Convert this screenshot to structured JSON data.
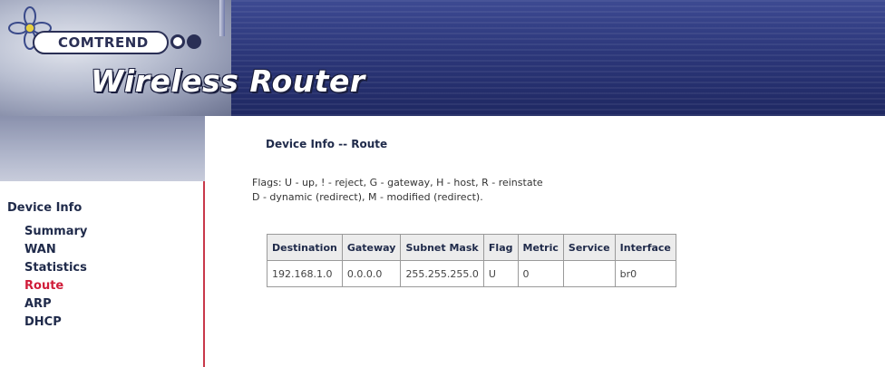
{
  "header": {
    "brand": "COMTREND",
    "product": "Wireless Router",
    "logo_icon": "flower-icon",
    "brand_color": "#2a2f55",
    "banner_color": "#2c377a"
  },
  "sidebar": {
    "heading": "Device Info",
    "items": [
      {
        "label": "Summary"
      },
      {
        "label": "WAN"
      },
      {
        "label": "Statistics"
      },
      {
        "label": "Route",
        "active": true
      },
      {
        "label": "ARP"
      },
      {
        "label": "DHCP"
      }
    ],
    "active_color": "#d01d3a"
  },
  "main": {
    "title": "Device Info -- Route",
    "flags_line1": "Flags: U - up, ! - reject, G - gateway, H - host, R - reinstate",
    "flags_line2": "D - dynamic (redirect), M - modified (redirect).",
    "table": {
      "columns": [
        "Destination",
        "Gateway",
        "Subnet Mask",
        "Flag",
        "Metric",
        "Service",
        "Interface"
      ],
      "rows": [
        [
          "192.168.1.0",
          "0.0.0.0",
          "255.255.255.0",
          "U",
          "0",
          "",
          "br0"
        ]
      ]
    }
  }
}
